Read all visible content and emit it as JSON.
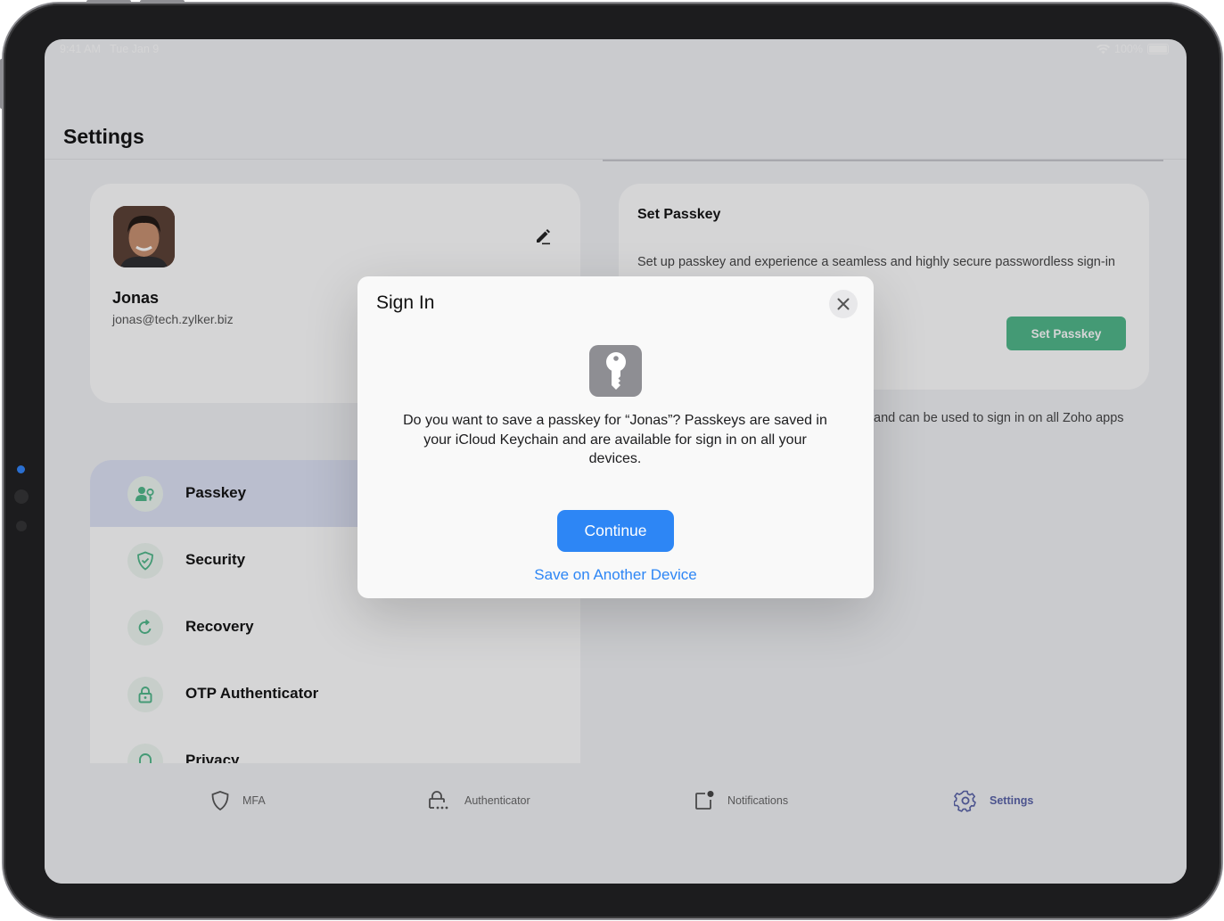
{
  "status_bar": {
    "time": "9:41 AM",
    "date": "Tue Jan 9",
    "battery": "100%"
  },
  "page": {
    "title": "Settings"
  },
  "profile": {
    "name": "Jonas",
    "email": "jonas@tech.zylker.biz"
  },
  "passkey_card": {
    "title": "Set Passkey",
    "description": "Set up passkey and experience a seamless and highly secure passwordless sign-in for your Zoho account.",
    "button_label": "Set Passkey",
    "partial_text": "and can be used to sign in on all Zoho apps"
  },
  "menu": {
    "items": [
      {
        "label": "Passkey",
        "icon": "user-key-icon",
        "active": true
      },
      {
        "label": "Security",
        "icon": "shield-check-icon",
        "active": false
      },
      {
        "label": "Recovery",
        "icon": "refresh-icon",
        "active": false
      },
      {
        "label": "OTP Authenticator",
        "icon": "lock-icon",
        "active": false
      },
      {
        "label": "Privacy",
        "icon": "privacy-icon",
        "active": false
      }
    ]
  },
  "tabbar": {
    "tabs": [
      {
        "label": "MFA",
        "icon": "shield-icon",
        "active": false
      },
      {
        "label": "Authenticator",
        "icon": "lock-dots-icon",
        "active": false
      },
      {
        "label": "Notifications",
        "icon": "notification-icon",
        "active": false
      },
      {
        "label": "Settings",
        "icon": "gear-icon",
        "active": true
      }
    ]
  },
  "dialog": {
    "title": "Sign In",
    "message": "Do you want to save a passkey for “Jonas”? Passkeys are saved in your iCloud Keychain and are available for sign in on all your devices.",
    "primary_button": "Continue",
    "secondary_link": "Save on Another Device"
  },
  "colors": {
    "accent_green": "#4fb889",
    "ios_blue": "#2d86f5",
    "active_tab": "#5862a8",
    "menu_active_bg": "#dfe3f6"
  }
}
